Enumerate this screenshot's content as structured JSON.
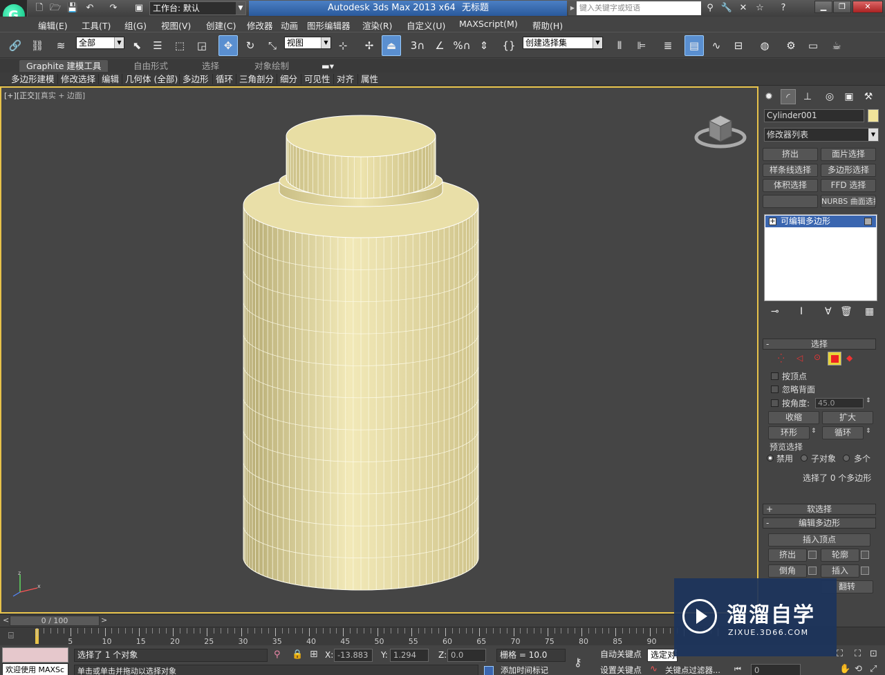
{
  "window": {
    "app_title": "Autodesk 3ds Max  2013 x64",
    "doc_title": "无标题",
    "workspace_label": "工作台: 默认",
    "search_placeholder": "键入关键字或短语"
  },
  "menu": [
    "编辑(E)",
    "工具(T)",
    "组(G)",
    "视图(V)",
    "创建(C)",
    "修改器",
    "动画",
    "图形编辑器",
    "渲染(R)",
    "自定义(U)",
    "MAXScript(M)",
    "帮助(H)"
  ],
  "toolbar": {
    "selection_filter": "全部",
    "ref_coord": "视图",
    "named_selection": "创建选择集",
    "snap_3": "3",
    "snap_percent": "%"
  },
  "ribbon": {
    "tabs": [
      "Graphite 建模工具",
      "自由形式",
      "选择",
      "对象绘制"
    ],
    "panels": [
      "多边形建模",
      "修改选择",
      "编辑",
      "几何体 (全部)",
      "多边形",
      "循环",
      "三角剖分",
      "细分",
      "可见性",
      "对齐",
      "属性"
    ]
  },
  "viewport": {
    "label_plus": "[+]",
    "label_view": "[正交]",
    "label_shading": "[真实 + 边面]",
    "object_fill": "#ebe1a6",
    "border_color": "#e8c34a"
  },
  "command_panel": {
    "object_name": "Cylinder001",
    "object_color": "#f1e49a",
    "modifier_list": "修改器列表",
    "modifier_buttons": [
      "挤出",
      "面片选择",
      "样条线选择",
      "多边形选择",
      "体积选择",
      "FFD 选择",
      "",
      "NURBS 曲面选择"
    ],
    "stack_item": "可编辑多边形",
    "selection": {
      "title": "选择",
      "by_vertex": "按顶点",
      "ignore_backfacing": "忽略背面",
      "by_angle": "按角度:",
      "angle_value": "45.0",
      "shrink": "收缩",
      "grow": "扩大",
      "ring": "环形",
      "loop": "循环",
      "preview_title": "预览选择",
      "preview_options": [
        "禁用",
        "子对象",
        "多个"
      ],
      "status": "选择了 0 个多边形"
    },
    "soft_selection": "软选择",
    "edit_polygons": {
      "title": "编辑多边形",
      "insert_vertex": "插入顶点",
      "extrude": "挤出",
      "outline": "轮廓",
      "bevel": "倒角",
      "inset": "插入",
      "flip": "翻转"
    }
  },
  "timeline": {
    "frame_display": "0 / 100",
    "ticks": [
      "5",
      "10",
      "15",
      "20",
      "25",
      "30",
      "35",
      "40",
      "45",
      "50",
      "55",
      "60",
      "65",
      "70",
      "75",
      "80",
      "85",
      "90"
    ]
  },
  "statusbar": {
    "welcome": "欢迎使用 MAXSc",
    "selected": "选择了 1 个对象",
    "prompt": "单击或单击并拖动以选择对象",
    "x_label": "X:",
    "x_value": "-13.883",
    "y_label": "Y:",
    "y_value": "1.294",
    "z_label": "Z:",
    "z_value": "0.0",
    "grid": "栅格 = 10.0",
    "auto_key": "自动关键点",
    "selected_obj": "选定对象",
    "set_key": "设置关键点",
    "key_filters": "关键点过滤器...",
    "add_time_tag": "添加时间标记",
    "frame_field": "0"
  },
  "watermark": {
    "title": "溜溜自学",
    "subtitle": "ZIXUE.3D66.COM"
  }
}
